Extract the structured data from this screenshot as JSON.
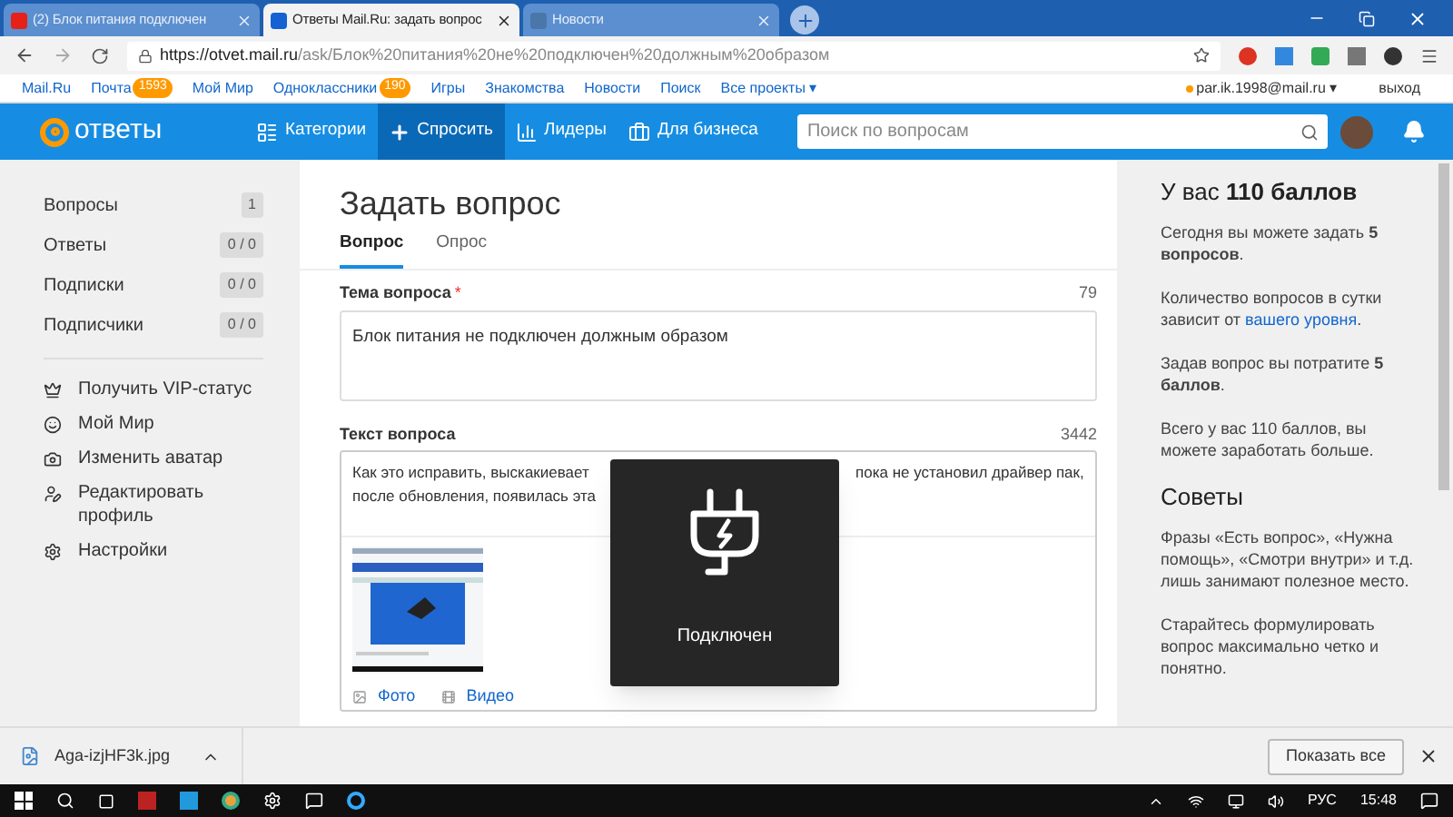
{
  "browser": {
    "tabs": [
      {
        "kind": "video",
        "title": "(2) Блок питания подключен",
        "selected": false
      },
      {
        "kind": "question",
        "title": "Ответы Mail.Ru: задать вопрос",
        "selected": true
      },
      {
        "kind": "news",
        "title": "Новости",
        "selected": false
      }
    ],
    "url_host": "https://otvet.mail.ru",
    "url_path": "/ask/Блок%20питания%20не%20подключен%20должным%20образом"
  },
  "portal_bar": {
    "links": [
      {
        "label": "Mail.Ru"
      },
      {
        "label": "Почта",
        "badge": "1593"
      },
      {
        "label": "Мой Мир"
      },
      {
        "label": "Одноклассники",
        "badge": "190"
      },
      {
        "label": "Игры"
      },
      {
        "label": "Знакомства"
      },
      {
        "label": "Новости"
      },
      {
        "label": "Поиск"
      },
      {
        "label": "Все проекты ▾"
      }
    ],
    "user": "par.ik.1998@mail.ru ▾",
    "logout": "выход"
  },
  "header": {
    "logo": "ответы",
    "nav": [
      {
        "kind": "list",
        "label": "Категории",
        "selected": false
      },
      {
        "kind": "plus",
        "label": "Спросить",
        "selected": true
      },
      {
        "kind": "bars",
        "label": "Лидеры",
        "selected": false
      },
      {
        "kind": "bag",
        "label": "Для бизнеса",
        "selected": false
      }
    ],
    "search_placeholder": "Поиск по вопросам"
  },
  "sidebar": {
    "counters": [
      {
        "label": "Вопросы",
        "count": "1"
      },
      {
        "label": "Ответы",
        "count": "0 / 0"
      },
      {
        "label": "Подписки",
        "count": "0 / 0"
      },
      {
        "label": "Подписчики",
        "count": "0 / 0"
      }
    ],
    "links": [
      {
        "kind": "crown",
        "label": "Получить VIP-статус"
      },
      {
        "kind": "smile",
        "label": "Мой Мир"
      },
      {
        "kind": "camera",
        "label": "Изменить аватар"
      },
      {
        "kind": "person",
        "label": "Редактировать профиль"
      },
      {
        "kind": "gear",
        "label": "Настройки"
      }
    ]
  },
  "form": {
    "title": "Задать вопрос",
    "tabs": [
      {
        "label": "Вопрос",
        "selected": true
      },
      {
        "label": "Опрос",
        "selected": false
      }
    ],
    "subject_label": "Тема вопроса",
    "required_mark": "*",
    "subject_counter": "79",
    "subject_value": "Блок питания не подключен должным образом",
    "text_label": "Текст вопроса",
    "text_counter": "3442",
    "text_lines": [
      {
        "left": "Как это исправить, выскакиевает",
        "right": "пока не установил драйвер пак,"
      },
      {
        "left": "после обновления, появилась эта"
      }
    ],
    "attachments": [
      {
        "label": "Фото"
      },
      {
        "kind": "video",
        "label": "Видео"
      }
    ]
  },
  "notification": {
    "label": "Подключен"
  },
  "right_panel": {
    "heading": "У вас **110 баллов**",
    "paragraphs": [
      {
        "text": "Сегодня вы можете задать **5 вопросов**."
      },
      {
        "text": "Количество вопросов в сутки зависит от",
        "link": "вашего уровня",
        "after": "."
      },
      {
        "text": "Задав вопрос вы потратите **5 баллов**."
      },
      {
        "text": "Всего у вас 110 баллов, вы можете заработать больше."
      }
    ],
    "tips_heading": "Советы",
    "tips": [
      "Фразы «Есть вопрос», «Нужна помощь», «Смотри внутри» и т.д. лишь занимают полезное место.",
      "Старайтесь формулировать вопрос максимально четко и понятно."
    ]
  },
  "downloads": {
    "file": "Aga-izjHF3k.jpg",
    "show_all": "Показать все"
  },
  "taskbar": {
    "language": "РУС",
    "time": "15:48"
  }
}
